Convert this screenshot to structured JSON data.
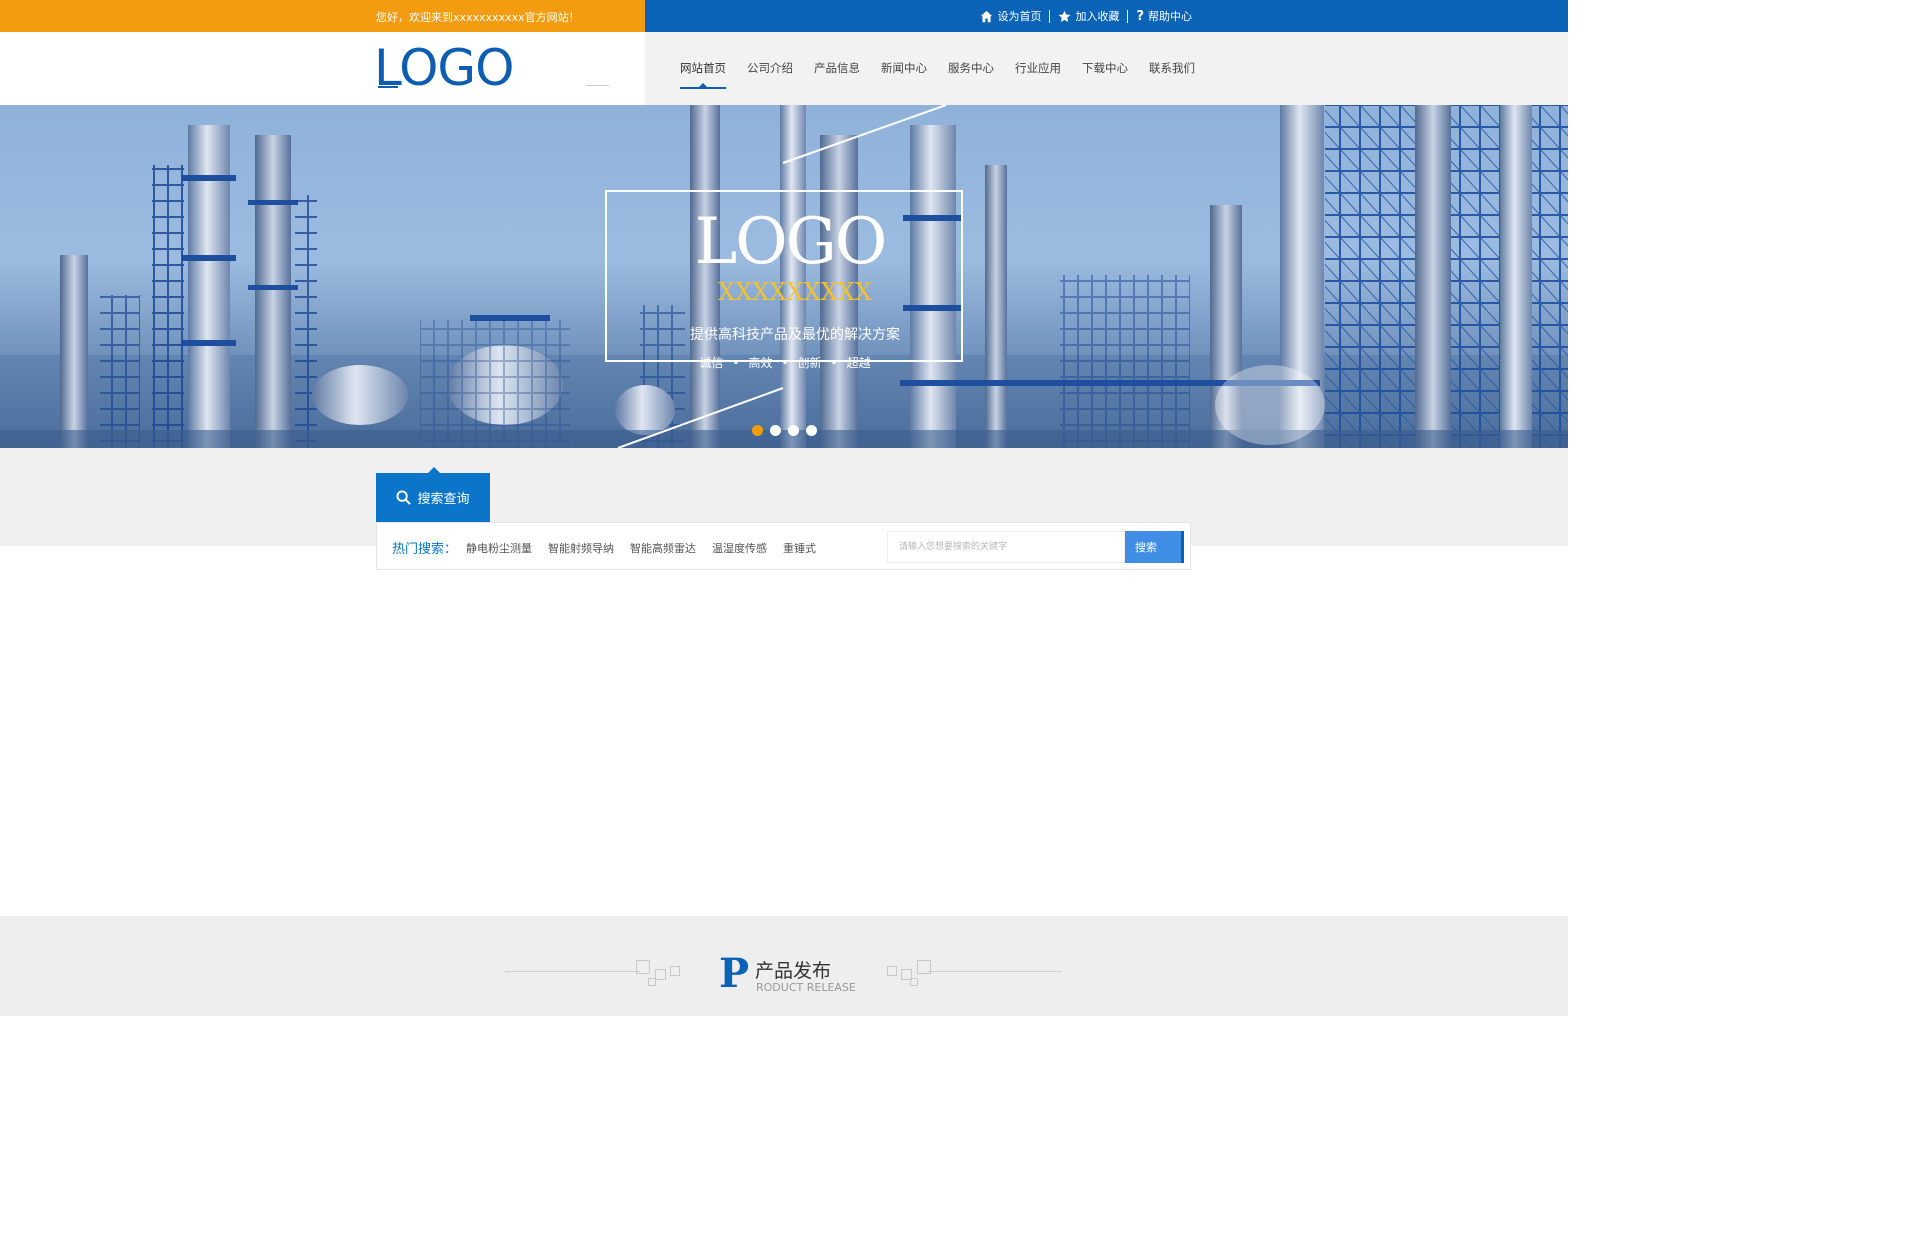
{
  "topbar": {
    "welcome": "您好，欢迎来到xxxxxxxxxxx官方网站！",
    "links": [
      {
        "label": "设为首页",
        "icon": "home-icon"
      },
      {
        "label": "加入收藏",
        "icon": "star-icon"
      },
      {
        "label": "帮助中心",
        "icon": "question-icon"
      }
    ],
    "colors": {
      "left": "#f39c0f",
      "right": "#0a63b6"
    }
  },
  "header": {
    "logo": "LOGO",
    "nav": [
      "网站首页",
      "公司介绍",
      "产品信息",
      "新闻中心",
      "服务中心",
      "行业应用",
      "下载中心",
      "联系我们"
    ],
    "active_nav": "网站首页"
  },
  "banner": {
    "title": "LOGO",
    "subtitle": "XXXXXXXXX",
    "slogan": "提供高科技产品及最优的解决方案",
    "values": [
      "诚信",
      "高效",
      "创新",
      "超越"
    ],
    "slide_count": 4,
    "active_slide": 1
  },
  "search": {
    "tab_label": "搜索查询",
    "hot_label": "热门搜索：",
    "hot_tags": [
      "静电粉尘测量",
      "智能射频导纳",
      "智能高频雷达",
      "温湿度传感",
      "重锤式"
    ],
    "placeholder": "请输入您想要搜索的关键字",
    "button_label": "搜索"
  },
  "products": {
    "letter": "P",
    "title": "产品发布",
    "subtitle": "RODUCT RELEASE"
  }
}
